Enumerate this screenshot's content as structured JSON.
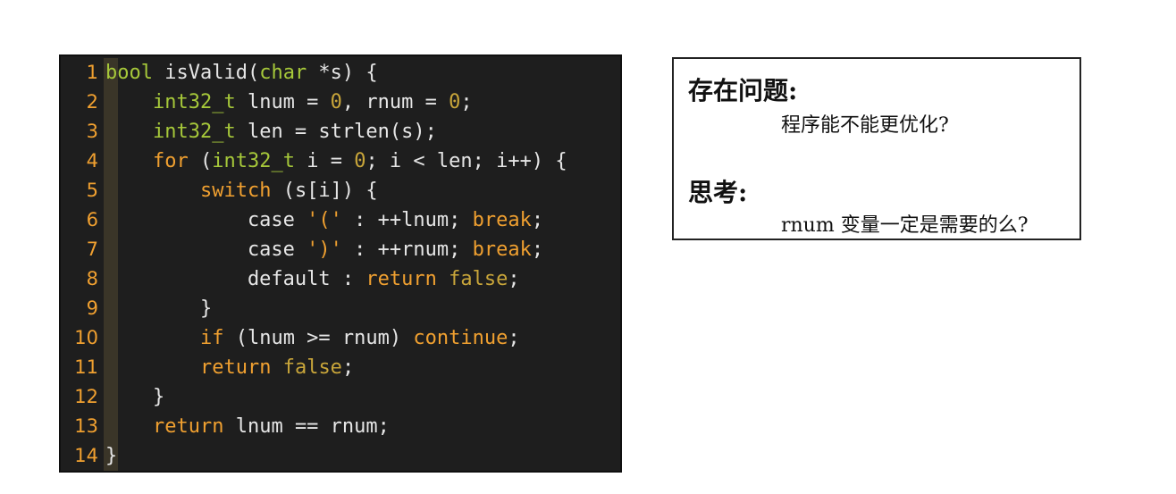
{
  "editor": {
    "lines": [
      {
        "num": "1",
        "tokens": [
          {
            "t": "bool",
            "c": "t-type"
          },
          {
            "t": " isValid(",
            "c": "t-plain"
          },
          {
            "t": "char",
            "c": "t-type"
          },
          {
            "t": " *s) {",
            "c": "t-plain"
          }
        ]
      },
      {
        "num": "2",
        "tokens": [
          {
            "t": "    ",
            "c": "t-plain"
          },
          {
            "t": "int32_t",
            "c": "t-type"
          },
          {
            "t": " lnum = ",
            "c": "t-plain"
          },
          {
            "t": "0",
            "c": "t-num"
          },
          {
            "t": ", rnum = ",
            "c": "t-plain"
          },
          {
            "t": "0",
            "c": "t-num"
          },
          {
            "t": ";",
            "c": "t-plain"
          }
        ]
      },
      {
        "num": "3",
        "tokens": [
          {
            "t": "    ",
            "c": "t-plain"
          },
          {
            "t": "int32_t",
            "c": "t-type"
          },
          {
            "t": " len = strlen(s);",
            "c": "t-plain"
          }
        ]
      },
      {
        "num": "4",
        "tokens": [
          {
            "t": "    ",
            "c": "t-plain"
          },
          {
            "t": "for",
            "c": "t-kw"
          },
          {
            "t": " (",
            "c": "t-plain"
          },
          {
            "t": "int32_t",
            "c": "t-type"
          },
          {
            "t": " i = ",
            "c": "t-plain"
          },
          {
            "t": "0",
            "c": "t-num"
          },
          {
            "t": "; i < len; i++) {",
            "c": "t-plain"
          }
        ]
      },
      {
        "num": "5",
        "tokens": [
          {
            "t": "        ",
            "c": "t-plain"
          },
          {
            "t": "switch",
            "c": "t-kw"
          },
          {
            "t": " (s[i]) {",
            "c": "t-plain"
          }
        ]
      },
      {
        "num": "6",
        "tokens": [
          {
            "t": "            case ",
            "c": "t-plain"
          },
          {
            "t": "'('",
            "c": "t-str"
          },
          {
            "t": " : ++lnum; ",
            "c": "t-plain"
          },
          {
            "t": "break",
            "c": "t-kw"
          },
          {
            "t": ";",
            "c": "t-plain"
          }
        ]
      },
      {
        "num": "7",
        "tokens": [
          {
            "t": "            case ",
            "c": "t-plain"
          },
          {
            "t": "')'",
            "c": "t-str"
          },
          {
            "t": " : ++rnum; ",
            "c": "t-plain"
          },
          {
            "t": "break",
            "c": "t-kw"
          },
          {
            "t": ";",
            "c": "t-plain"
          }
        ]
      },
      {
        "num": "8",
        "tokens": [
          {
            "t": "            default : ",
            "c": "t-plain"
          },
          {
            "t": "return",
            "c": "t-kw"
          },
          {
            "t": " ",
            "c": "t-plain"
          },
          {
            "t": "false",
            "c": "t-lit"
          },
          {
            "t": ";",
            "c": "t-plain"
          }
        ]
      },
      {
        "num": "9",
        "tokens": [
          {
            "t": "        }",
            "c": "t-plain"
          }
        ]
      },
      {
        "num": "10",
        "tokens": [
          {
            "t": "        ",
            "c": "t-plain"
          },
          {
            "t": "if",
            "c": "t-kw"
          },
          {
            "t": " (lnum >= rnum) ",
            "c": "t-plain"
          },
          {
            "t": "continue",
            "c": "t-kw"
          },
          {
            "t": ";",
            "c": "t-plain"
          }
        ]
      },
      {
        "num": "11",
        "tokens": [
          {
            "t": "        ",
            "c": "t-plain"
          },
          {
            "t": "return",
            "c": "t-kw"
          },
          {
            "t": " ",
            "c": "t-plain"
          },
          {
            "t": "false",
            "c": "t-lit"
          },
          {
            "t": ";",
            "c": "t-plain"
          }
        ]
      },
      {
        "num": "12",
        "tokens": [
          {
            "t": "    }",
            "c": "t-plain"
          }
        ]
      },
      {
        "num": "13",
        "tokens": [
          {
            "t": "    ",
            "c": "t-plain"
          },
          {
            "t": "return",
            "c": "t-kw"
          },
          {
            "t": " lnum == rnum;",
            "c": "t-plain"
          }
        ]
      },
      {
        "num": "14",
        "tokens": [
          {
            "t": "}",
            "c": "t-plain"
          }
        ]
      }
    ]
  },
  "notes": {
    "heading1": "存在问题:",
    "body1": "程序能不能更优化?",
    "heading2": "思考:",
    "body2": "rnum 变量一定是需要的么?"
  },
  "colors": {
    "editor_bg": "#1e1e1e",
    "line_number": "#f0a030",
    "type": "#a6c83a",
    "keyword": "#f0a030",
    "literal": "#c9a63a"
  }
}
